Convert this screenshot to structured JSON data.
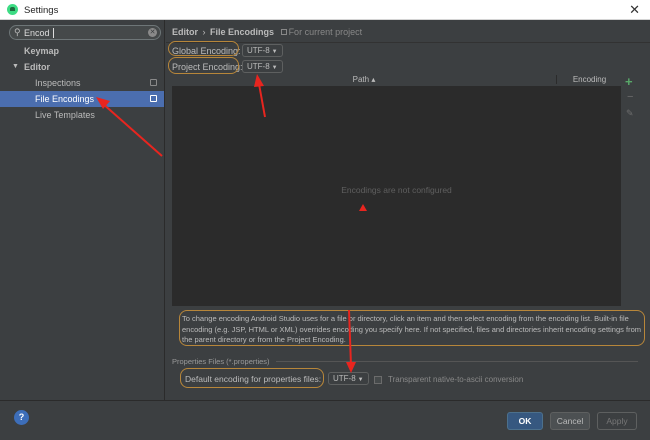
{
  "window": {
    "title": "Settings",
    "close_glyph": "✕"
  },
  "sidebar": {
    "search": {
      "value": "Encod",
      "icon": "search-icon",
      "clear_glyph": "✕"
    },
    "items": [
      {
        "label": "Keymap",
        "level": 0
      },
      {
        "label": "Editor",
        "level": 0,
        "expanded": true
      },
      {
        "label": "Inspections",
        "level": 1
      },
      {
        "label": "File Encodings",
        "level": 1,
        "selected": true
      },
      {
        "label": "Live Templates",
        "level": 1
      }
    ]
  },
  "main": {
    "breadcrumb": {
      "parent": "Editor",
      "separator": "›",
      "current": "File Encodings",
      "note": "For current project"
    },
    "global_encoding": {
      "label": "Global Encoding:",
      "value": "UTF-8"
    },
    "project_encoding": {
      "label": "Project Encoding:",
      "value": "UTF-8"
    },
    "table": {
      "columns": [
        "Path ▴",
        "Encoding"
      ],
      "empty_text": "Encodings are not configured"
    },
    "tools": {
      "add": "+",
      "remove": "−",
      "edit": "✎"
    },
    "info_text": "To change encoding Android Studio uses for a file or directory, click an item and then select encoding from the encoding list. Built-in file encoding (e.g. JSP, HTML or XML) overrides encoding you specify here. If not specified, files and directories inherit encoding settings from the parent directory or from the Project Encoding.",
    "properties": {
      "section_title": "Properties Files (*.properties)",
      "default_label": "Default encoding for properties files:",
      "default_value": "UTF-8",
      "transparent_label": "Transparent native-to-ascii conversion",
      "transparent_checked": false
    }
  },
  "footer": {
    "help": "?",
    "ok": "OK",
    "cancel": "Cancel",
    "apply": "Apply"
  },
  "colors": {
    "background": "#3c3f41",
    "selection": "#4b6eaf",
    "annotation": "#b7863a",
    "arrow": "#e8251f",
    "ok_button": "#365880"
  }
}
